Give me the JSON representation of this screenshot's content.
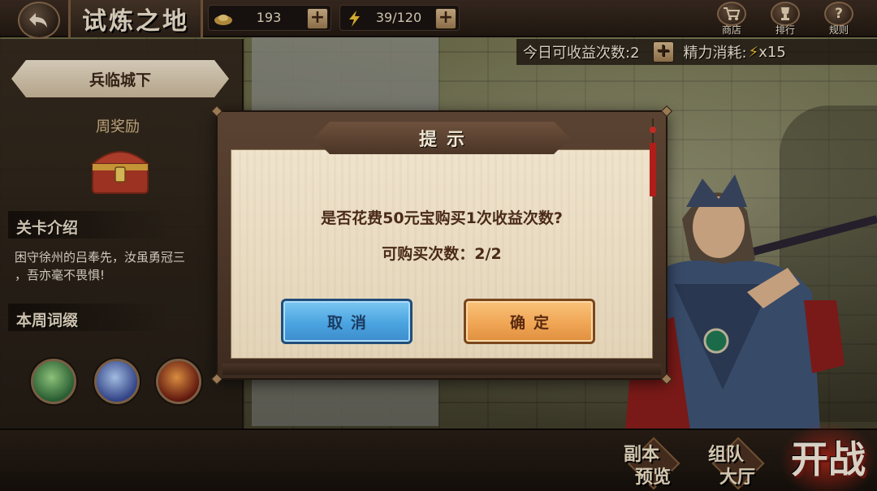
{
  "header": {
    "title": "试炼之地",
    "currency": {
      "value": "193",
      "icon": "gold-ingot-icon"
    },
    "stamina": {
      "value": "39/120",
      "icon": "lightning-bolt-icon"
    },
    "buttons": [
      {
        "id": "shop",
        "label": "商店",
        "icon": "shopping-cart-icon"
      },
      {
        "id": "ranking",
        "label": "排行",
        "icon": "trophy-icon"
      },
      {
        "id": "rules",
        "label": "规则",
        "icon": "question-mark-icon"
      }
    ]
  },
  "info_line": {
    "daily_attempts": "今日可收益次数:2",
    "stamina_cost": "精力消耗:",
    "stamina_cost_value": "x15"
  },
  "left_panel": {
    "stage_name": "兵临城下",
    "weekly_reward_label": "周奖励",
    "intro_heading": "关卡介绍",
    "intro_lines": [
      "困守徐州的吕奉先，汝虽勇冠三",
      "，吾亦毫不畏惧!"
    ],
    "affix_heading": "本周词缀",
    "affix_icons": [
      "green-poison-affix-icon",
      "blue-whirlwind-affix-icon",
      "red-fire-affix-icon"
    ]
  },
  "bottom": {
    "dungeon_preview": {
      "line1": "副本",
      "line2": "预览"
    },
    "team_hall": {
      "line1": "组队",
      "line2": "大厅"
    },
    "fight": "开战"
  },
  "dialog": {
    "title": "提示",
    "message": "是否花费50元宝购买1次收益次数?",
    "purchase_count": "可购买次数：2/2",
    "cancel": "取消",
    "confirm": "确定"
  },
  "colors": {
    "cancel_button": "#4aa4e0",
    "confirm_button": "#f0a655",
    "paper": "#efe3cc",
    "frame": "#4b3526"
  }
}
